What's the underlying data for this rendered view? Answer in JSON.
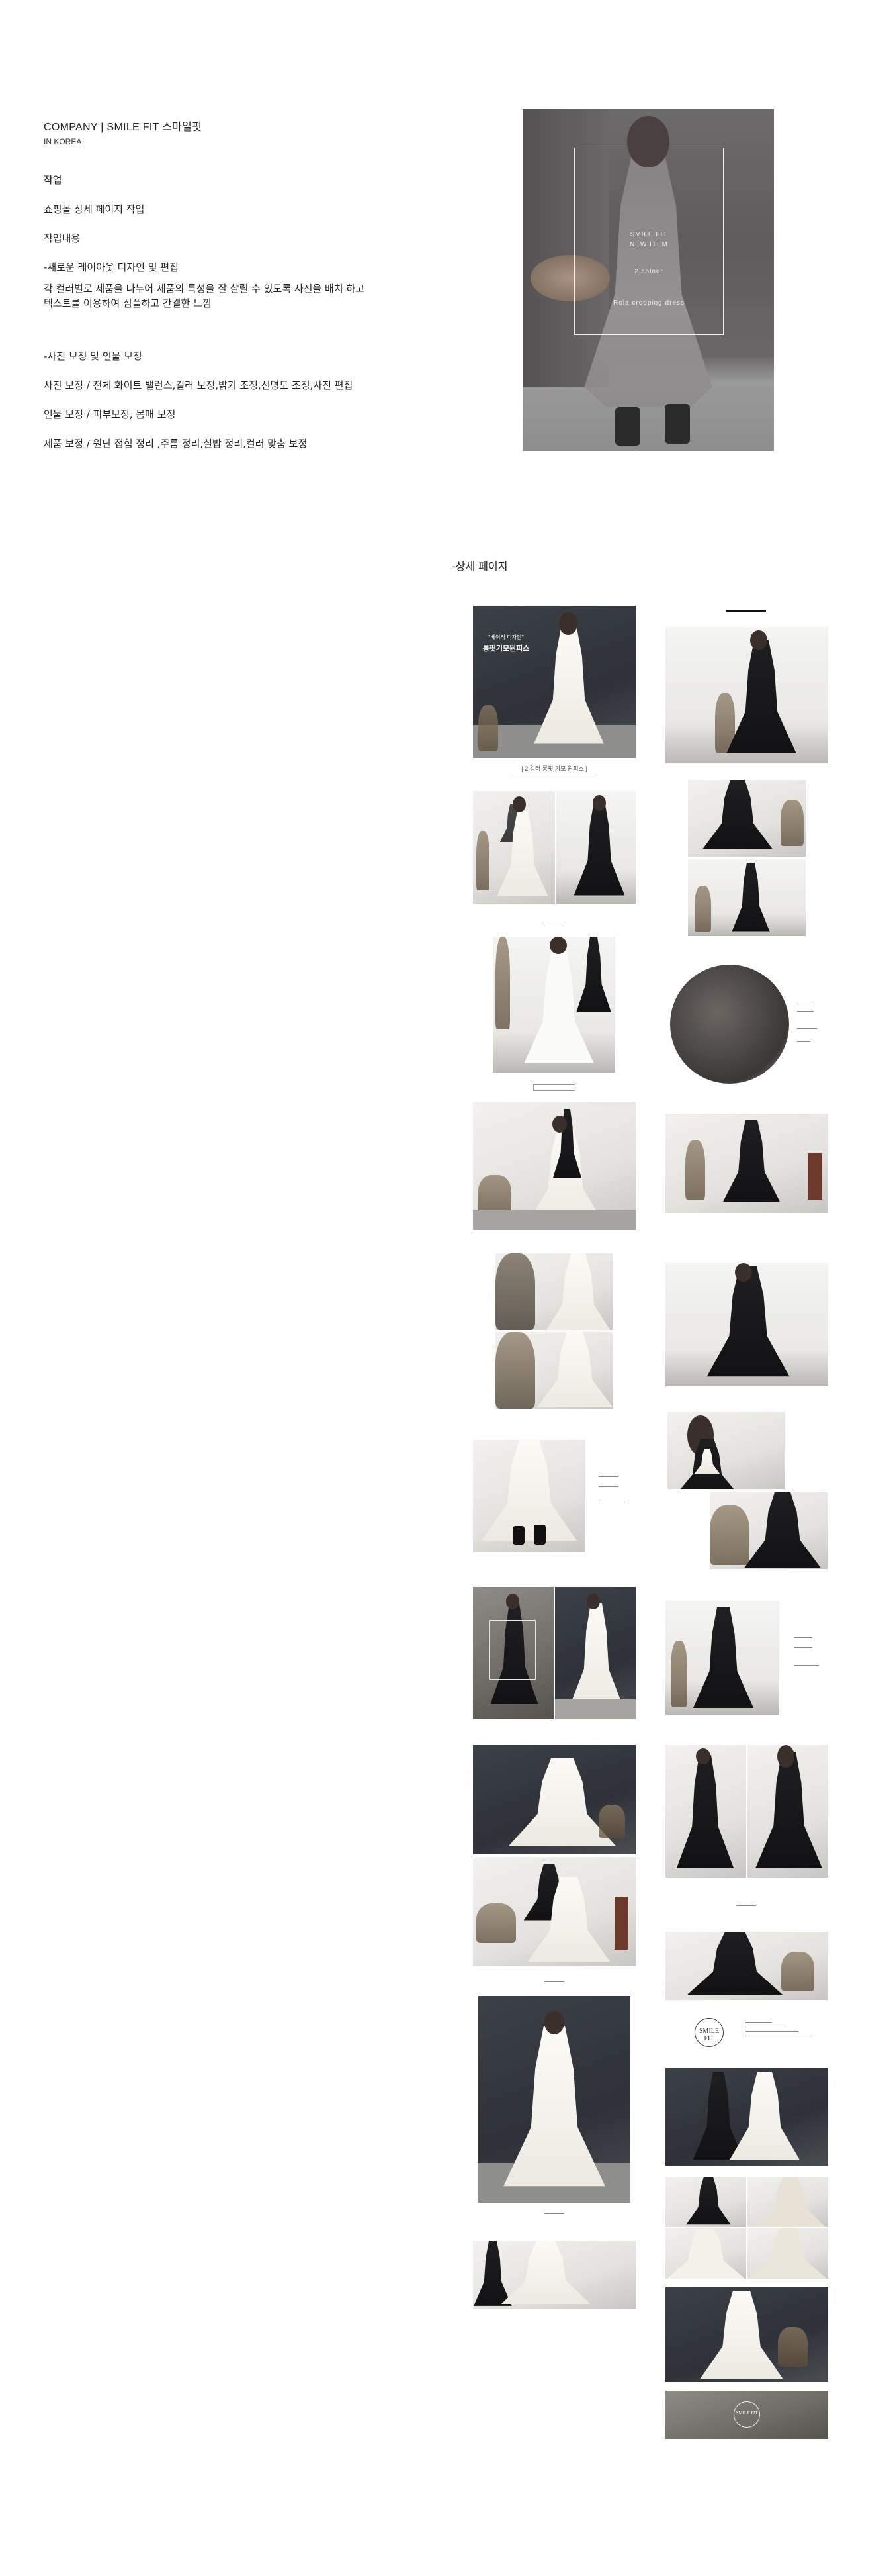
{
  "intro": {
    "company": "COMPANY | SMILE FIT 스마일핏",
    "country": "IN KOREA",
    "work_label": "작업",
    "work_value": "쇼핑몰 상세 페이지 작업",
    "content_label": "작업내용",
    "layout_prefix": "-새로운 ",
    "layout_highlight": "레이아웃 디자인 및 편집",
    "layout_desc_line1": "각 컬러별로 제품을 나누어 제품의 특성을 잘 살릴 수 있도록 사진을 배치 하고",
    "layout_desc_line2": "텍스트를 이용하여 심플하고 간결한 느낌",
    "retouch_title": "-사진 보정 및 인물 보정",
    "retouch_photo": "사진 보정 / 전체 화이트 밸런스,컬러 보정,밝기 조정,선명도 조정,사진 편집",
    "retouch_person": "인물 보정 / 피부보정, 몸매 보정",
    "retouch_product": "제품 보정 / 원단 접힘 정리 ,주름 정리,실밥 정리,컬러 맞춤 보정"
  },
  "hero": {
    "brand": "SMILE FIT",
    "new_item": "NEW ITEM",
    "colour": "2 colour",
    "product": "Rola cropping  dress"
  },
  "detail": {
    "section_title": "-상세 페이지",
    "banner_small": "\"베이직 디자인\"",
    "banner_title": "롱핏기모원피스",
    "caption": "[ 2 컬러 롱핏 기모 원피스 ]",
    "badge_brand": "SMILE FIT",
    "badge_small": "smile fit",
    "end_badge": "SMILE FIT"
  },
  "colors": {
    "highlight": "#f08a8a",
    "text": "#222222",
    "hero_frame": "#f0f0f0"
  }
}
